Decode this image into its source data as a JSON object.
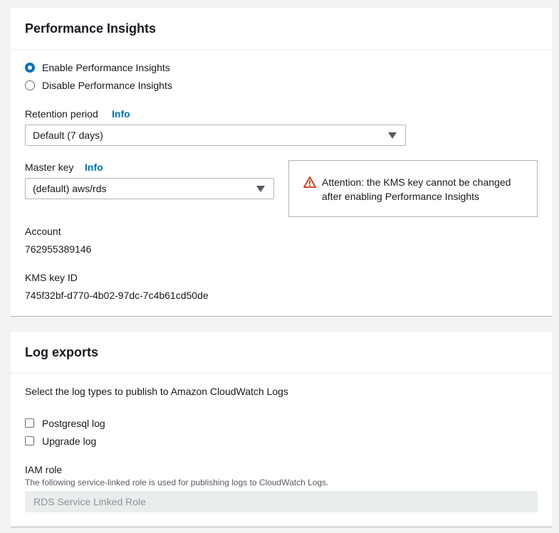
{
  "performance_insights": {
    "title": "Performance Insights",
    "radio_options": [
      {
        "label": "Enable Performance Insights",
        "checked": true
      },
      {
        "label": "Disable Performance Insights",
        "checked": false
      }
    ],
    "retention": {
      "label": "Retention period",
      "info": "Info",
      "value": "Default (7 days)"
    },
    "master_key": {
      "label": "Master key",
      "info": "Info",
      "value": "(default) aws/rds"
    },
    "alert": {
      "icon": "warning-triangle-icon",
      "text": "Attention: the KMS key cannot be changed after enabling Performance Insights"
    },
    "account": {
      "label": "Account",
      "value": "762955389146"
    },
    "kms_key_id": {
      "label": "KMS key ID",
      "value": "745f32bf-d770-4b02-97dc-7c4b61cd50de"
    }
  },
  "log_exports": {
    "title": "Log exports",
    "description": "Select the log types to publish to Amazon CloudWatch Logs",
    "checkboxes": [
      {
        "label": "Postgresql log",
        "checked": false
      },
      {
        "label": "Upgrade log",
        "checked": false
      }
    ],
    "iam_role": {
      "label": "IAM role",
      "description": "The following service-linked role is used for publishing logs to CloudWatch Logs.",
      "value": "RDS Service Linked Role"
    }
  },
  "colors": {
    "accent": "#0073bb",
    "warning": "#d13212",
    "background": "#f2f3f3"
  }
}
